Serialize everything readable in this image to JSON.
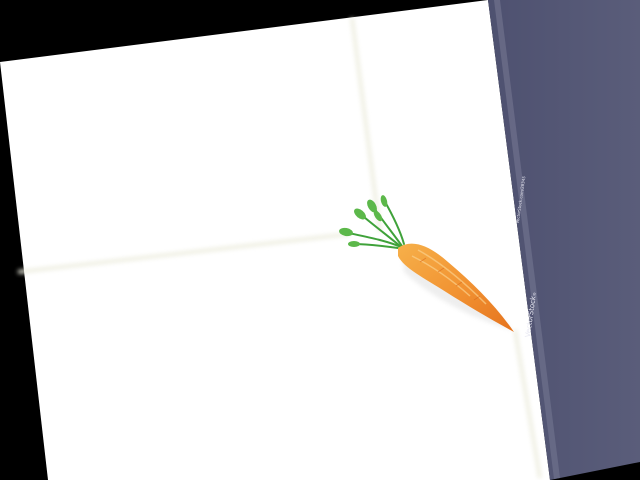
{
  "image": {
    "subject": "carrit-photo",
    "background_color": "#ffffff",
    "outer_color": "#000000",
    "sidebar_color": "#555874"
  },
  "watermark": {
    "brand": "VectorStock",
    "reg_mark": "®",
    "credit": "VectorStock.com/28345"
  },
  "icons": {
    "carrot": "carrot-icon",
    "tile_lines": "tile-grout-lines"
  }
}
